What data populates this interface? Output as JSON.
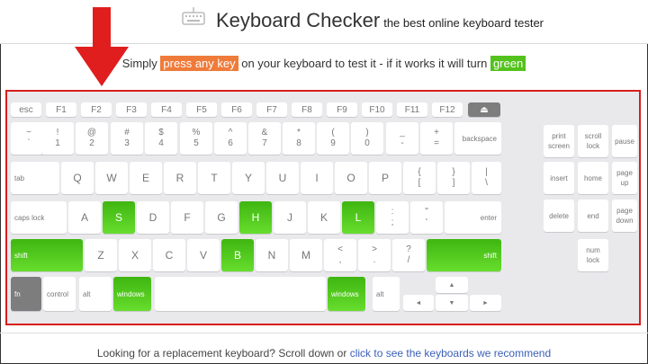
{
  "header": {
    "title": "Keyboard Checker",
    "subtitle": "the best online keyboard tester"
  },
  "instruction": {
    "pre": "Simply ",
    "highlight": "press any key",
    "mid": " on your keyboard to test it - if it works it will turn ",
    "green": "green"
  },
  "colors": {
    "accent_orange": "#ef7b3a",
    "pressed_green": "#54c21c",
    "frame_red": "#d81e1e",
    "arrow_red": "#e01e1e",
    "link": "#3a5fb8"
  },
  "keys": {
    "esc": "esc",
    "f1": "F1",
    "f2": "F2",
    "f3": "F3",
    "f4": "F4",
    "f5": "F5",
    "f6": "F6",
    "f7": "F7",
    "f8": "F8",
    "f9": "F9",
    "f10": "F10",
    "f11": "F11",
    "f12": "F12",
    "eject": "⏏",
    "tilde_top": "~",
    "tilde_bot": "`",
    "n1_top": "!",
    "n1_bot": "1",
    "n2_top": "@",
    "n2_bot": "2",
    "n3_top": "#",
    "n3_bot": "3",
    "n4_top": "$",
    "n4_bot": "4",
    "n5_top": "%",
    "n5_bot": "5",
    "n6_top": "^",
    "n6_bot": "6",
    "n7_top": "&",
    "n7_bot": "7",
    "n8_top": "*",
    "n8_bot": "8",
    "n9_top": "(",
    "n9_bot": "9",
    "n0_top": ")",
    "n0_bot": "0",
    "minus_top": "_",
    "minus_bot": "-",
    "equal_top": "+",
    "equal_bot": "=",
    "backspace": "backspace",
    "tab": "tab",
    "q": "Q",
    "w": "W",
    "e": "E",
    "r": "R",
    "t": "T",
    "y": "Y",
    "u": "U",
    "i": "I",
    "o": "O",
    "p": "P",
    "lbracket_top": "{",
    "lbracket_bot": "[",
    "rbracket_top": "}",
    "rbracket_bot": "]",
    "backslash_top": "|",
    "backslash_bot": "\\",
    "capslock": "caps lock",
    "a": "A",
    "s": "S",
    "d": "D",
    "f": "F",
    "g": "G",
    "h": "H",
    "j": "J",
    "k": "K",
    "l": "L",
    "semicolon_top": ":",
    "semicolon_bot": ";",
    "quote_top": "\"",
    "quote_bot": "'",
    "enter": "enter",
    "lshift": "shift",
    "z": "Z",
    "x": "X",
    "c": "C",
    "v": "V",
    "b": "B",
    "n": "N",
    "m": "M",
    "comma_top": "<",
    "comma_bot": ",",
    "period_top": ">",
    "period_bot": ".",
    "slash_top": "?",
    "slash_bot": "/",
    "rshift": "shift",
    "fn": "fn",
    "control": "control",
    "alt": "alt",
    "windows": "windows",
    "ralt": "alt",
    "rwindows": "windows",
    "up": "▲",
    "left": "◄",
    "down": "▼",
    "right": "►",
    "printscreen_1": "print",
    "printscreen_2": "screen",
    "scrolllock_1": "scroll",
    "scrolllock_2": "lock",
    "pause": "pause",
    "insert": "insert",
    "home": "home",
    "pageup_1": "page",
    "pageup_2": "up",
    "delete": "delete",
    "end": "end",
    "pagedown_1": "page",
    "pagedown_2": "down",
    "numlock_1": "num",
    "numlock_2": "lock"
  },
  "footer": {
    "text": "Looking for a replacement keyboard? Scroll down or ",
    "link": "click to see the keyboards we recommend"
  }
}
